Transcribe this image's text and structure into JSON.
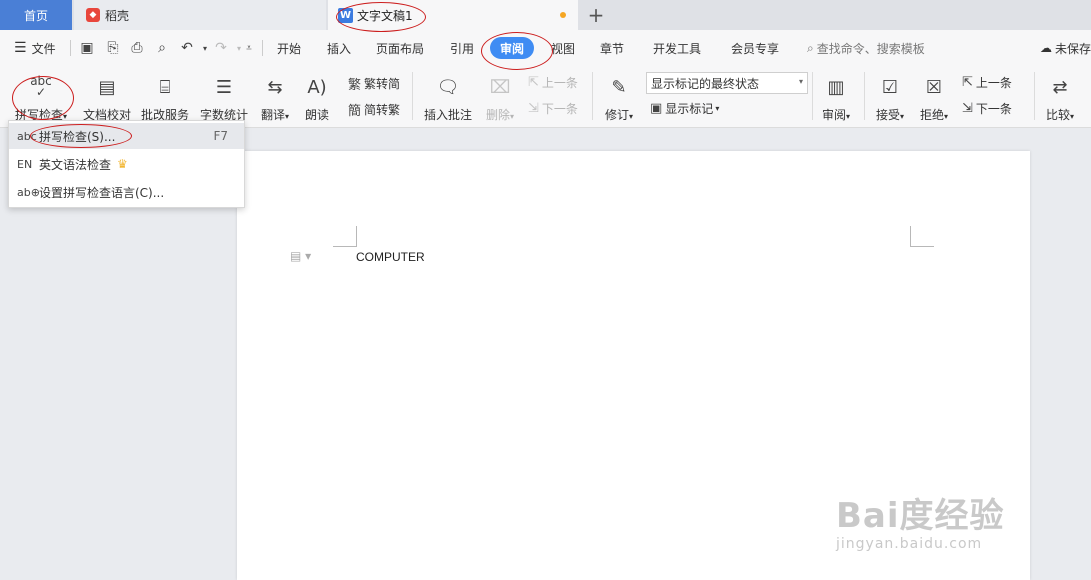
{
  "tabs": {
    "home": "首页",
    "daoke": "稻壳",
    "doc": "文字文稿1",
    "add": "+"
  },
  "menu": {
    "file": "文件",
    "items": [
      "开始",
      "插入",
      "页面布局",
      "引用",
      "审阅",
      "视图",
      "章节",
      "开发工具",
      "会员专享"
    ],
    "active": "审阅",
    "search": "查找命令、搜索模板",
    "unsynced": "未保存"
  },
  "ribbon": {
    "spellcheck": "拼写检查",
    "proofread": "文档校对",
    "review_service": "批改服务",
    "word_count": "字数统计",
    "translate": "翻译",
    "read_aloud": "朗读",
    "trad_to_simp": "繁转简",
    "simp_to_trad": "简转繁",
    "insert_comment": "插入批注",
    "delete": "删除",
    "prev_comment": "上一条",
    "next_comment": "下一条",
    "track_changes": "修订",
    "markup_state": "显示标记的最终状态",
    "show_markup": "显示标记",
    "review": "审阅",
    "accept": "接受",
    "reject": "拒绝",
    "prev_change": "上一条",
    "next_change": "下一条",
    "compare": "比较"
  },
  "dropdown": {
    "items": [
      {
        "label": "拼写检查(S)...",
        "shortcut": "F7"
      },
      {
        "label": "英文语法检查",
        "shortcut": ""
      },
      {
        "label": "设置拼写检查语言(C)...",
        "shortcut": ""
      }
    ]
  },
  "document": {
    "text": "COMPUTER"
  },
  "watermark": {
    "main": "Bai度经验",
    "sub": "jingyan.baidu.com"
  },
  "colors": {
    "accent": "#3f8cf3",
    "annotation": "#cc1e1e",
    "home_tab": "#4a7fd6"
  }
}
